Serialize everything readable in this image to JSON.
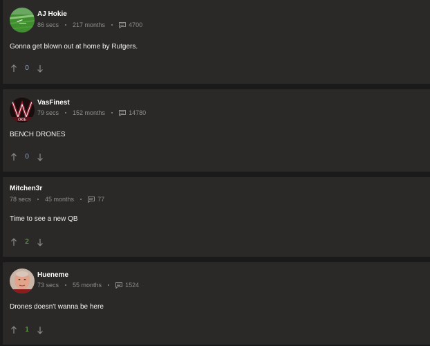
{
  "comments": [
    {
      "username": "AJ Hokie",
      "time": "86 secs",
      "tenure": "217 months",
      "post_count": "4700",
      "text": "Gonna get blown out at home by Rutgers.",
      "score": "0",
      "avatar": "avatar-field-icon"
    },
    {
      "username": "VasFinest",
      "time": "79 secs",
      "tenure": "152 months",
      "post_count": "14780",
      "text": "BENCH DRONES",
      "score": "0",
      "avatar": "avatar-vt-logo-icon"
    },
    {
      "username": "Mitchen3r",
      "time": "78 secs",
      "tenure": "45 months",
      "post_count": "77",
      "text": "Time to see a new QB",
      "score": "2"
    },
    {
      "username": "Hueneme",
      "time": "73 secs",
      "tenure": "55 months",
      "post_count": "1524",
      "text": "Drones doesn't wanna be here",
      "score": "1",
      "avatar": "avatar-face-icon"
    }
  ],
  "colors": {
    "card_bg": "#2a2927",
    "page_bg": "#1a1a1a",
    "meta_text": "#8e8e8e",
    "score_neutral": "#8fa6bd",
    "score_positive": "#6fc94d"
  }
}
